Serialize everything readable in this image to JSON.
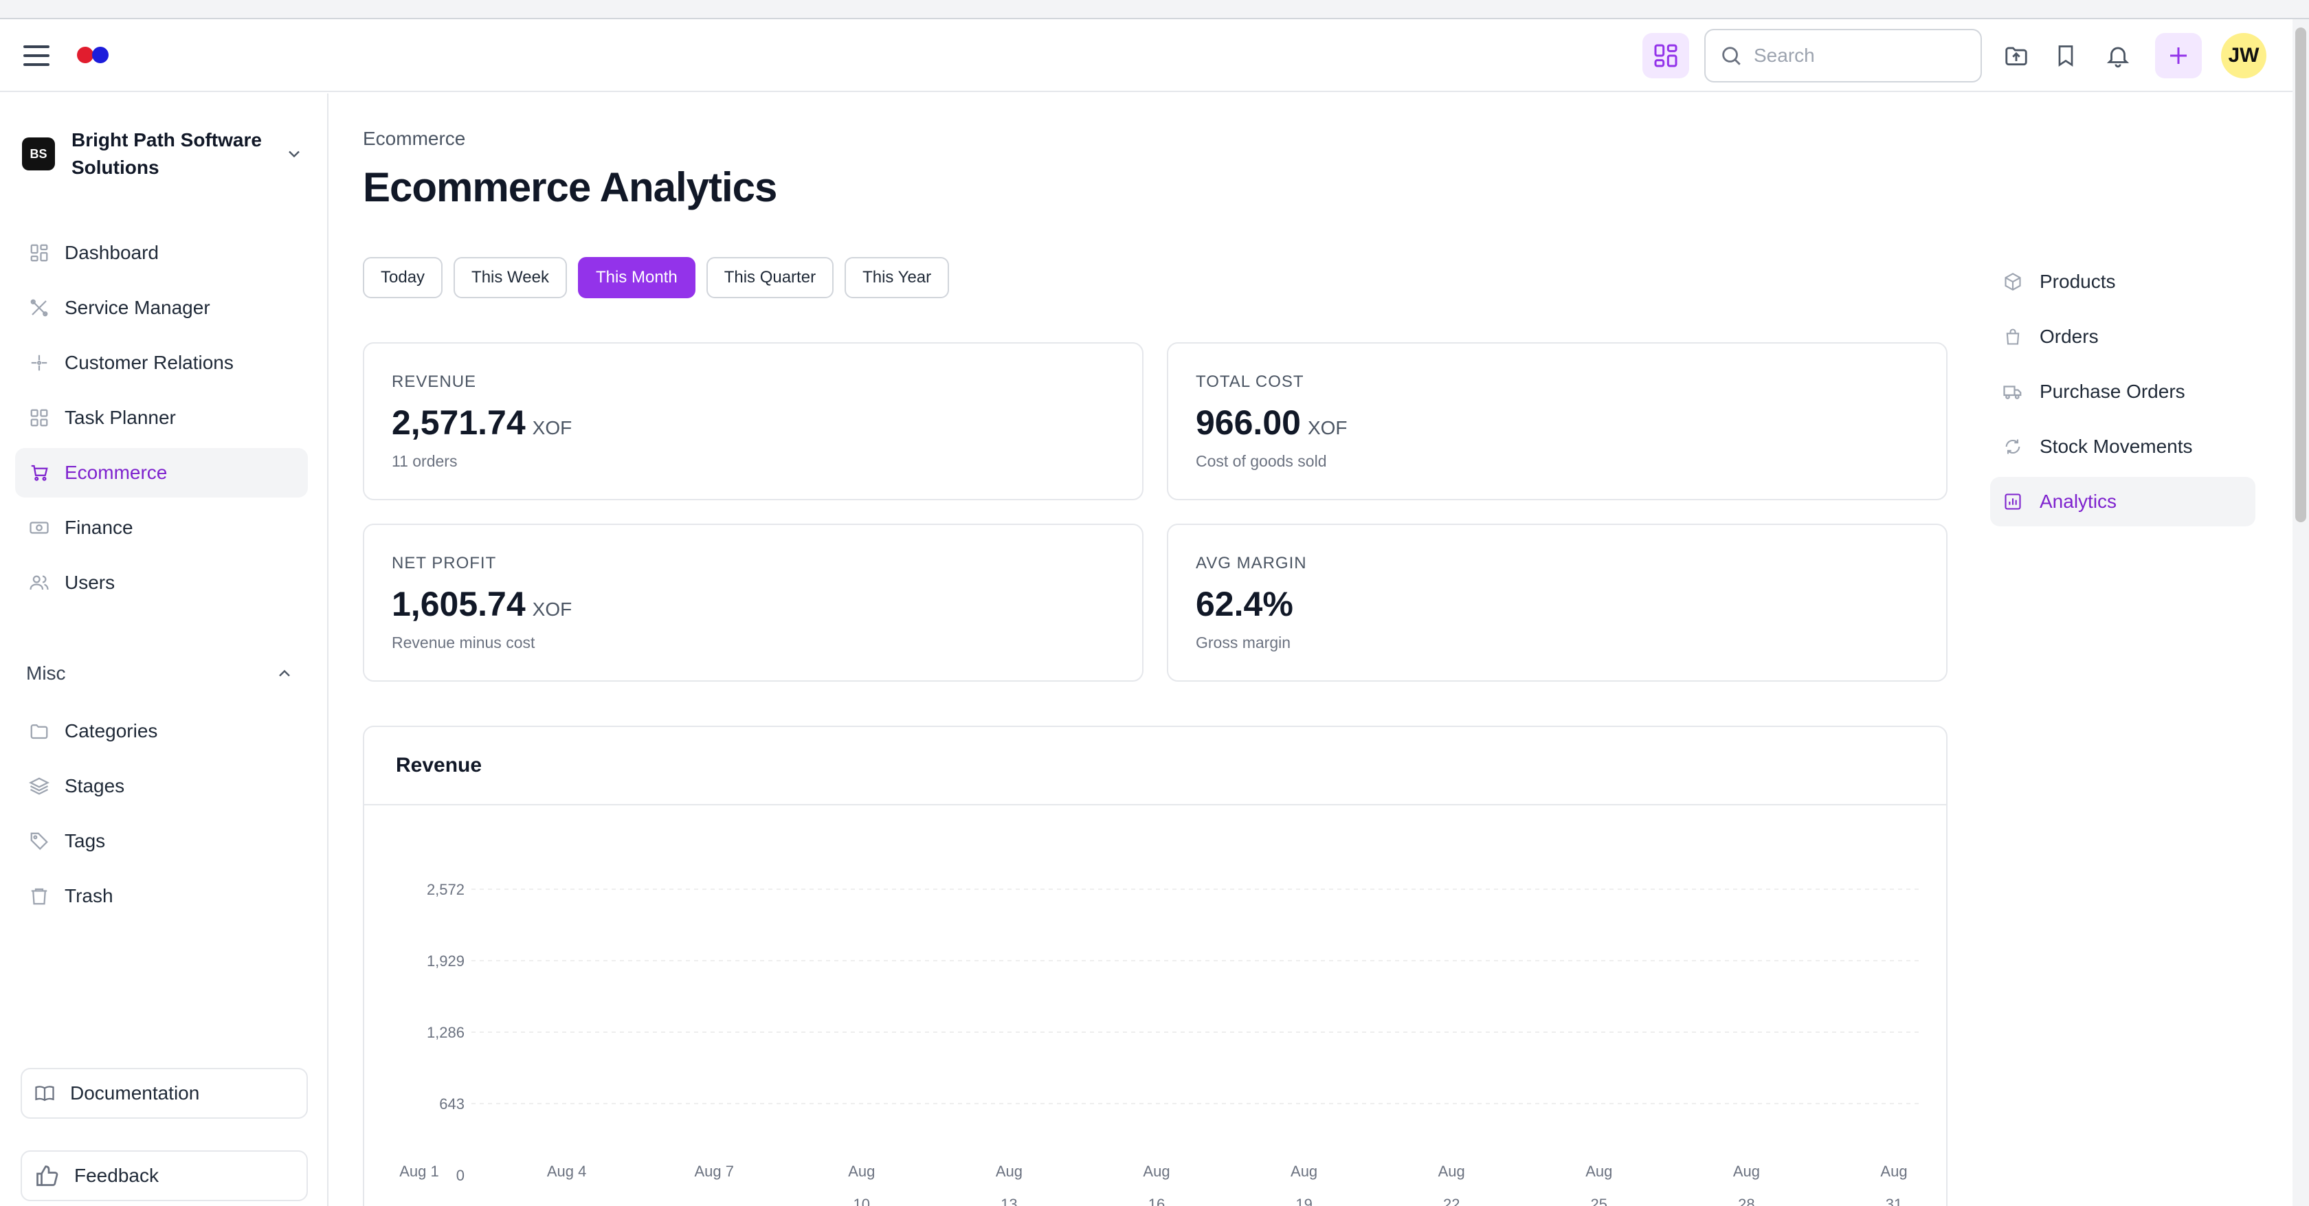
{
  "header": {
    "search_placeholder": "Search",
    "avatar_initials": "JW"
  },
  "sidebar": {
    "org_badge": "BS",
    "org_name": "Bright Path Software Solutions",
    "items": [
      {
        "label": "Dashboard",
        "icon": "dashboard-icon"
      },
      {
        "label": "Service Manager",
        "icon": "tools-icon"
      },
      {
        "label": "Customer Relations",
        "icon": "sparkle-icon"
      },
      {
        "label": "Task Planner",
        "icon": "grid-icon"
      },
      {
        "label": "Ecommerce",
        "icon": "cart-icon",
        "active": true
      },
      {
        "label": "Finance",
        "icon": "money-icon"
      },
      {
        "label": "Users",
        "icon": "users-icon"
      }
    ],
    "misc_label": "Misc",
    "misc_items": [
      {
        "label": "Categories",
        "icon": "folder-icon"
      },
      {
        "label": "Stages",
        "icon": "layers-icon"
      },
      {
        "label": "Tags",
        "icon": "tag-icon"
      },
      {
        "label": "Trash",
        "icon": "trash-icon"
      }
    ],
    "documentation_label": "Documentation",
    "feedback_label": "Feedback"
  },
  "main": {
    "breadcrumb": "Ecommerce",
    "title": "Ecommerce Analytics",
    "periods": [
      {
        "label": "Today"
      },
      {
        "label": "This Week"
      },
      {
        "label": "This Month",
        "active": true
      },
      {
        "label": "This Quarter"
      },
      {
        "label": "This Year"
      }
    ],
    "stats": [
      {
        "label": "REVENUE",
        "value": "2,571.74",
        "unit": "XOF",
        "sub": "11 orders"
      },
      {
        "label": "TOTAL COST",
        "value": "966.00",
        "unit": "XOF",
        "sub": "Cost of goods sold"
      },
      {
        "label": "NET PROFIT",
        "value": "1,605.74",
        "unit": "XOF",
        "sub": "Revenue minus cost"
      },
      {
        "label": "AVG MARGIN",
        "value": "62.4%",
        "unit": "",
        "sub": "Gross margin"
      }
    ],
    "revenue_title": "Revenue"
  },
  "right_nav": [
    {
      "label": "Products",
      "icon": "box-icon"
    },
    {
      "label": "Orders",
      "icon": "bag-icon"
    },
    {
      "label": "Purchase Orders",
      "icon": "truck-icon"
    },
    {
      "label": "Stock Movements",
      "icon": "refresh-icon"
    },
    {
      "label": "Analytics",
      "icon": "chart-icon",
      "active": true
    }
  ],
  "colors": {
    "accent": "#9333ea",
    "active_text": "#7e22ce",
    "active_bg": "#f3f4f6"
  },
  "chart_data": {
    "type": "line",
    "title": "Revenue",
    "y_ticks": [
      "0",
      "643",
      "1,929",
      "1,286",
      "2,572"
    ],
    "yticks_ordered": [
      "0",
      "643",
      "1,286",
      "1,929",
      "2,572"
    ],
    "ylim": [
      0,
      2572
    ],
    "x_ticks": [
      [
        "Aug 1"
      ],
      [
        "Aug 4"
      ],
      [
        "Aug 7"
      ],
      [
        "Aug",
        "10"
      ],
      [
        "Aug",
        "13"
      ],
      [
        "Aug",
        "16"
      ],
      [
        "Aug",
        "19"
      ],
      [
        "Aug",
        "22"
      ],
      [
        "Aug",
        "25"
      ],
      [
        "Aug",
        "28"
      ],
      [
        "Aug",
        "31"
      ]
    ],
    "series": [],
    "grid": true
  }
}
